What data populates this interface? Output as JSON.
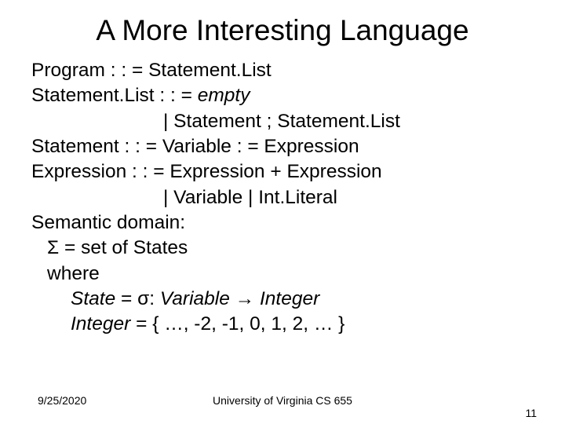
{
  "title": "A More Interesting Language",
  "lines": {
    "l1": "Program : : = Statement.List",
    "l2a": "Statement.List : : = ",
    "l2b": "empty",
    "l3": "| Statement ; Statement.List",
    "l4": "Statement : : = Variable : = Expression",
    "l5": "Expression : : = Expression + Expression",
    "l6": "| Variable | Int.Literal",
    "l7": "Semantic domain:",
    "l8": "Σ = set of States",
    "l9": "where",
    "l10a": "State",
    "l10b": " = σ: ",
    "l10c": "Variable",
    "l10d": " → ",
    "l10e": "Integer",
    "l11a": "Integer",
    "l11b": " = { …, -2, -1, 0, 1, 2, … }"
  },
  "footer": {
    "date": "9/25/2020",
    "center": "University of Virginia CS 655",
    "page": "11"
  }
}
